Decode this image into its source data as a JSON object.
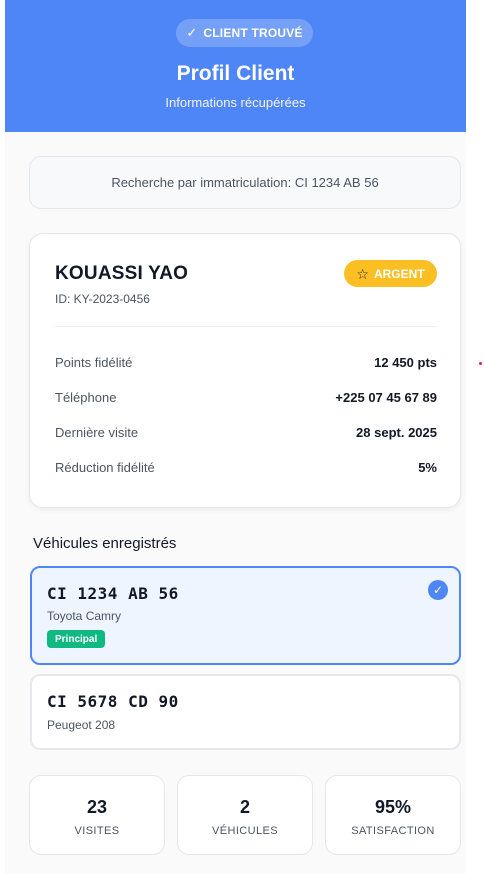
{
  "header": {
    "pill_check": "✓",
    "pill_label": "CLIENT TROUVÉ",
    "title": "Profil Client",
    "subtitle": "Informations récupérées"
  },
  "search": {
    "text": "Recherche par immatriculation: CI 1234 AB 56"
  },
  "client": {
    "name": "KOUASSI YAO",
    "id": "ID: KY-2023-0456",
    "badge_icon": "star-icon",
    "badge_label": "ARGENT",
    "details": [
      {
        "label": "Points fidélité",
        "value": "12 450 pts"
      },
      {
        "label": "Téléphone",
        "value": "+225 07 45 67 89"
      },
      {
        "label": "Dernière visite",
        "value": "28 sept. 2025"
      },
      {
        "label": "Réduction fidélité",
        "value": "5%"
      }
    ]
  },
  "vehicles": {
    "title": "Véhicules enregistrés",
    "items": [
      {
        "plate": "CI 1234 AB 56",
        "model": "Toyota Camry",
        "tag": "Principal",
        "selected": true
      },
      {
        "plate": "CI 5678 CD 90",
        "model": "Peugeot 208",
        "selected": false
      }
    ]
  },
  "stats": [
    {
      "value": "23",
      "label": "VISITES"
    },
    {
      "value": "2",
      "label": "VÉHICULES"
    },
    {
      "value": "95%",
      "label": "SATISFACTION"
    }
  ],
  "colors": {
    "primary": "#4f86f7",
    "badge": "#fbbf24",
    "tag": "#10b981"
  }
}
